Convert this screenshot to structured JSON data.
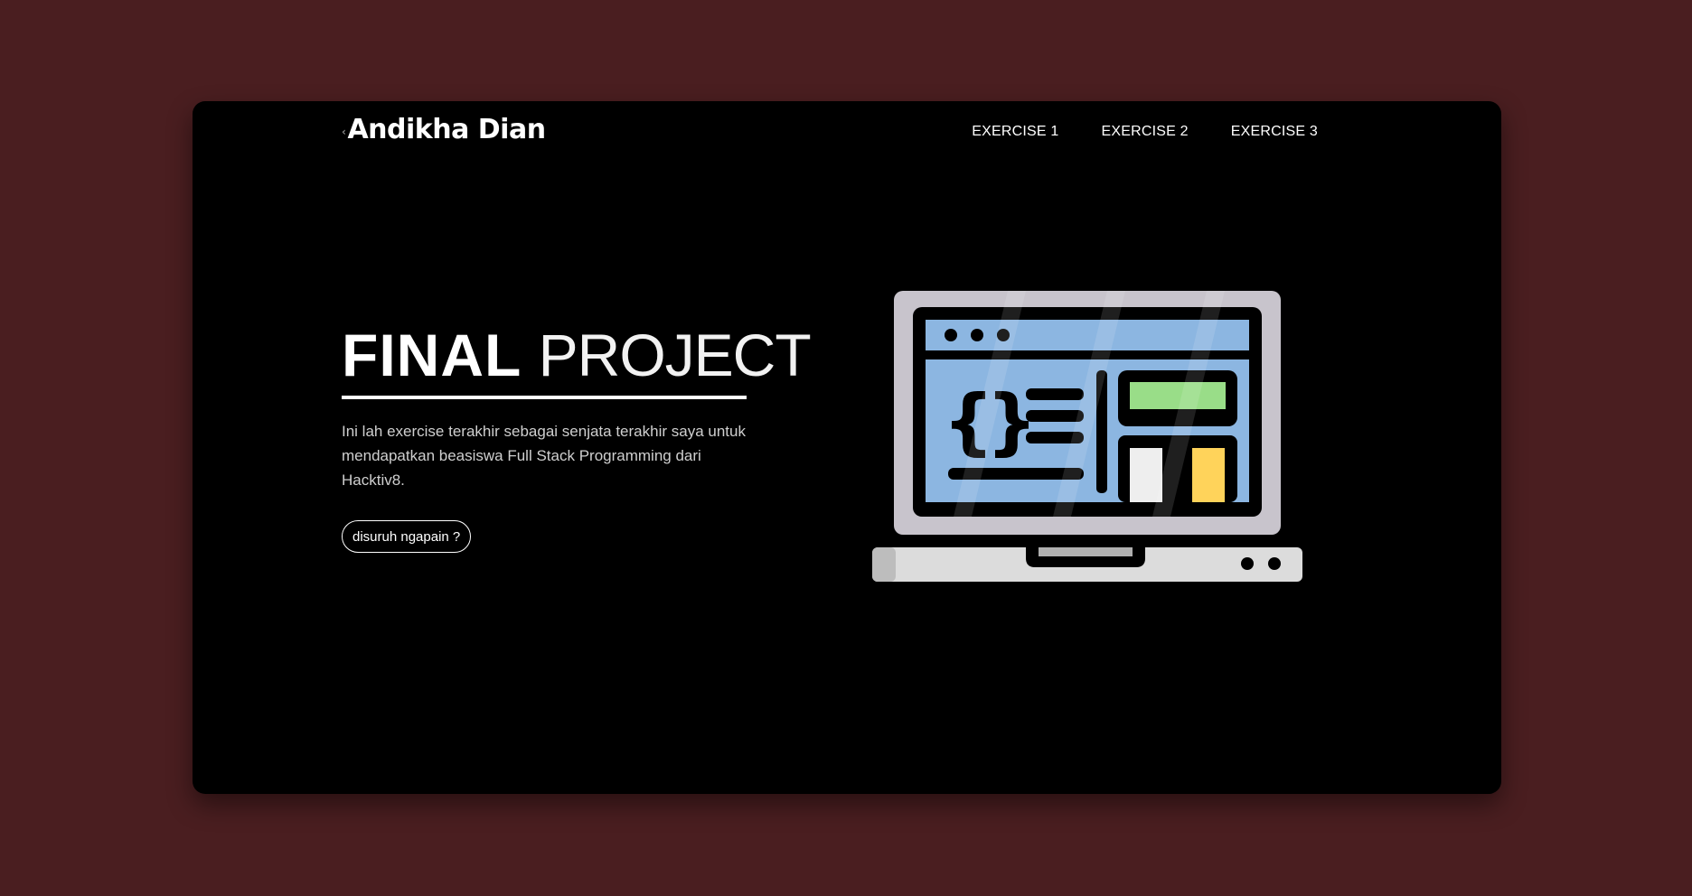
{
  "brand": {
    "name": "Andikha Dian"
  },
  "nav": {
    "items": [
      {
        "label": "EXERCISE 1"
      },
      {
        "label": "EXERCISE 2"
      },
      {
        "label": "EXERCISE 3"
      }
    ]
  },
  "hero": {
    "title_bold": "FINAL",
    "title_light": "PROJECT",
    "description": "Ini lah exercise terakhir sebagai senjata terakhir saya untuk mendapatkan beasiswa Full Stack Programming dari Hacktiv8.",
    "button_label": "disuruh ngapain ?",
    "illustration_icon": "laptop-code-icon"
  },
  "colors": {
    "page_background": "#4a1e20",
    "card_background": "#000000",
    "text_primary": "#ffffff",
    "text_secondary": "#cfcfcf",
    "screen_blue": "#8cb6e1",
    "chart_green": "#99dd88",
    "chart_yellow": "#ffd35a",
    "laptop_gray": "#c8c4cc"
  }
}
